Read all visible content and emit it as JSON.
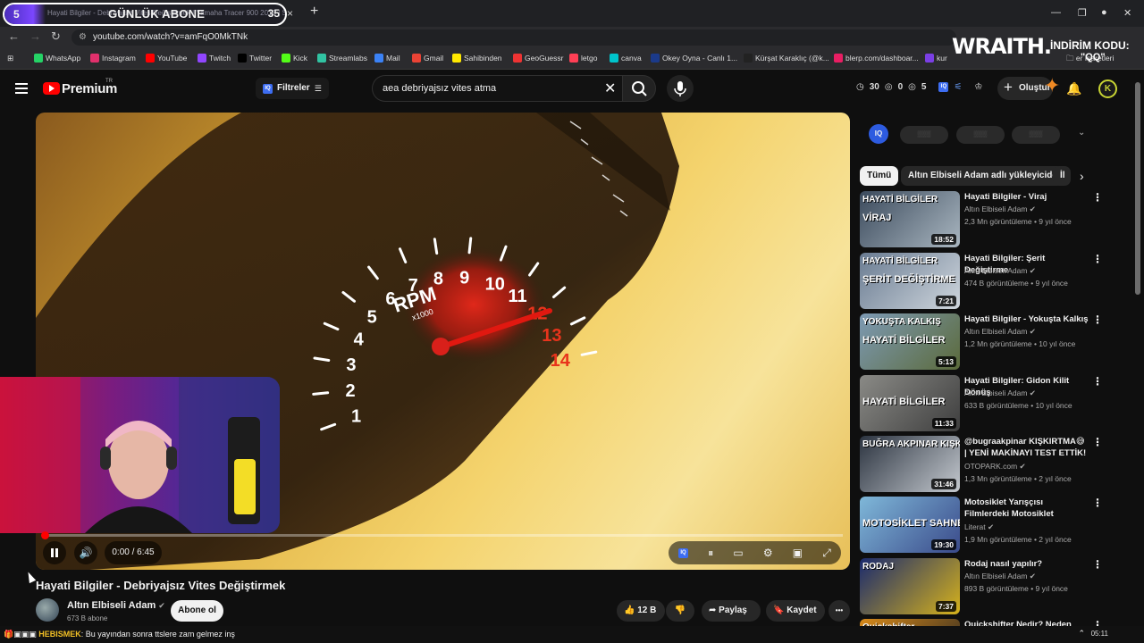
{
  "browser": {
    "overlay": {
      "left_count": "5",
      "label": "GÜNLÜK ABONE",
      "right_count": "35",
      "tab_ghost": "Hayati Bilgiler - Debriyajsız Vites Değiştirmek | Yamaha Tracer 900 2019 | S"
    },
    "tab_close": "×",
    "new_tab": "+",
    "url": "youtube.com/watch?v=amFqO0MkTNk",
    "bookmarks": [
      {
        "label": "WhatsApp",
        "color": "#25d366"
      },
      {
        "label": "Instagram",
        "color": "#e1306c"
      },
      {
        "label": "YouTube",
        "color": "#ff0000"
      },
      {
        "label": "Twitch",
        "color": "#9146ff"
      },
      {
        "label": "Twitter",
        "color": "#000000"
      },
      {
        "label": "Kick",
        "color": "#53fc18"
      },
      {
        "label": "Streamlabs",
        "color": "#31c3a2"
      },
      {
        "label": "Mail",
        "color": "#3b82f6"
      },
      {
        "label": "Gmail",
        "color": "#ea4335"
      },
      {
        "label": "Sahibinden",
        "color": "#ffe800"
      },
      {
        "label": "GeoGuessr",
        "color": "#e33"
      },
      {
        "label": "letgo",
        "color": "#ff3f55"
      },
      {
        "label": "canva",
        "color": "#00c4cc"
      },
      {
        "label": "Okey Oyna - Canlı 1...",
        "color": "#1b3a8a"
      },
      {
        "label": "Kürşat Karaklıç (@k...",
        "color": "#222222"
      },
      {
        "label": "blerp.com/dashboar...",
        "color": "#e91e63"
      },
      {
        "label": "kur",
        "color": "#7b3fe4"
      }
    ],
    "bookmarks_folder": "er İşaretleri"
  },
  "sponsor": {
    "brand": "WRAITH.",
    "promo": "İNDİRİM KODU:",
    "code": "\"QQ\""
  },
  "youtube": {
    "logo_text": "Premium",
    "region": "TR",
    "filters_label": "Filtreler",
    "search_value": "aea debriyajsız vites atma",
    "stats": [
      "30",
      "0",
      "5"
    ],
    "create_label": "Oluştur",
    "avatar_letter": "K"
  },
  "player": {
    "rpm_label": "RPM",
    "rpm_sub": "x1000",
    "gauge_numbers": [
      "1",
      "2",
      "3",
      "4",
      "5",
      "6",
      "7",
      "8",
      "9",
      "10",
      "11",
      "12",
      "13",
      "14"
    ],
    "time": "0:00 / 6:45",
    "progress": 0.0
  },
  "video": {
    "title": "Hayati Bilgiler - Debriyajsız Vites Değiştirmek",
    "channel": "Altın Elbiseli Adam",
    "subscribers": "673 B abone",
    "subscribe_label": "Abone ol",
    "likes": "12 B",
    "share_label": "Paylaş",
    "save_label": "Kaydet",
    "more": "•••"
  },
  "sidebar": {
    "iq_label": "IQ",
    "chips": [
      "Tümü",
      "Altın Elbiseli Adam adlı yükleyiciden",
      "İl"
    ],
    "recommendations": [
      {
        "title": "Hayati Bilgiler - Viraj",
        "channel": "Altın Elbiseli Adam",
        "meta": "2,3 Mn görüntüleme • 9 yıl önce",
        "duration": "18:52",
        "thumb_text": "HAYATİ BİLGİLER",
        "thumb_text2": "VİRAJ",
        "colors": [
          "#3b4a5c",
          "#a9b6c0"
        ]
      },
      {
        "title": "Hayati Bilgiler: Şerit Değiştirme",
        "channel": "Altın Elbiseli Adam",
        "meta": "474 B görüntüleme • 9 yıl önce",
        "duration": "7:21",
        "thumb_text": "HAYATİ BİLGİLER",
        "thumb_text2": "ŞERİT DEĞİŞTİRME",
        "colors": [
          "#6a7c92",
          "#cfd6dd"
        ]
      },
      {
        "title": "Hayati Bilgiler - Yokuşta Kalkış",
        "channel": "Altın Elbiseli Adam",
        "meta": "1,2 Mn görüntüleme • 10 yıl önce",
        "duration": "5:13",
        "thumb_text": "YOKUŞTA KALKIŞ",
        "thumb_text2": "HAYATİ BİLGİLER",
        "colors": [
          "#7d9ab4",
          "#5b6a3a"
        ]
      },
      {
        "title": "Hayati Bilgiler: Gidon Kilit Dönüş",
        "channel": "Altın Elbiseli Adam",
        "meta": "633 B görüntüleme • 10 yıl önce",
        "duration": "11:33",
        "thumb_text": "",
        "thumb_text2": "HAYATİ BİLGİLER",
        "colors": [
          "#8a8a86",
          "#3e3e3e"
        ]
      },
      {
        "title": "@bugraakpinar KIŞKIRTMA😅 | YENİ MAKİNAYI TEST ETTİK! ...",
        "channel": "OTOPARK.com",
        "meta": "1,3 Mn görüntüleme • 2 yıl önce",
        "duration": "31:46",
        "thumb_text": "BUĞRA AKPINAR KIŞKIRTMA !",
        "thumb_text2": "",
        "colors": [
          "#2c3440",
          "#c4c9cf"
        ]
      },
      {
        "title": "Motosiklet Yarışçısı Filmlerdeki Motosiklet Sahnelerini İzliyor I ...",
        "channel": "Literat",
        "meta": "1,9 Mn görüntüleme • 2 yıl önce",
        "duration": "19:30",
        "thumb_text": "",
        "thumb_text2": "MOTOSİKLET SAHNELERİ",
        "colors": [
          "#7fb8d9",
          "#3a4a8a"
        ]
      },
      {
        "title": "Rodaj nasıl yapılır?",
        "channel": "Altın Elbiseli Adam",
        "meta": "893 B görüntüleme • 9 yıl önce",
        "duration": "7:37",
        "thumb_text": "RODAJ",
        "thumb_text2": "",
        "colors": [
          "#1a2a6e",
          "#d6b21c"
        ]
      },
      {
        "title": "Quickshifter Nedir? Neden",
        "channel": "",
        "meta": "",
        "duration": "",
        "thumb_text": "Quickshifter",
        "thumb_text2": "",
        "colors": [
          "#d88a1a",
          "#222222"
        ]
      }
    ]
  },
  "ticker": {
    "user": "HEBISMEK",
    "message": ": Bu yayından sonra ttslere zam gelmez inş"
  },
  "taskbar": {
    "clock": "05:11"
  }
}
